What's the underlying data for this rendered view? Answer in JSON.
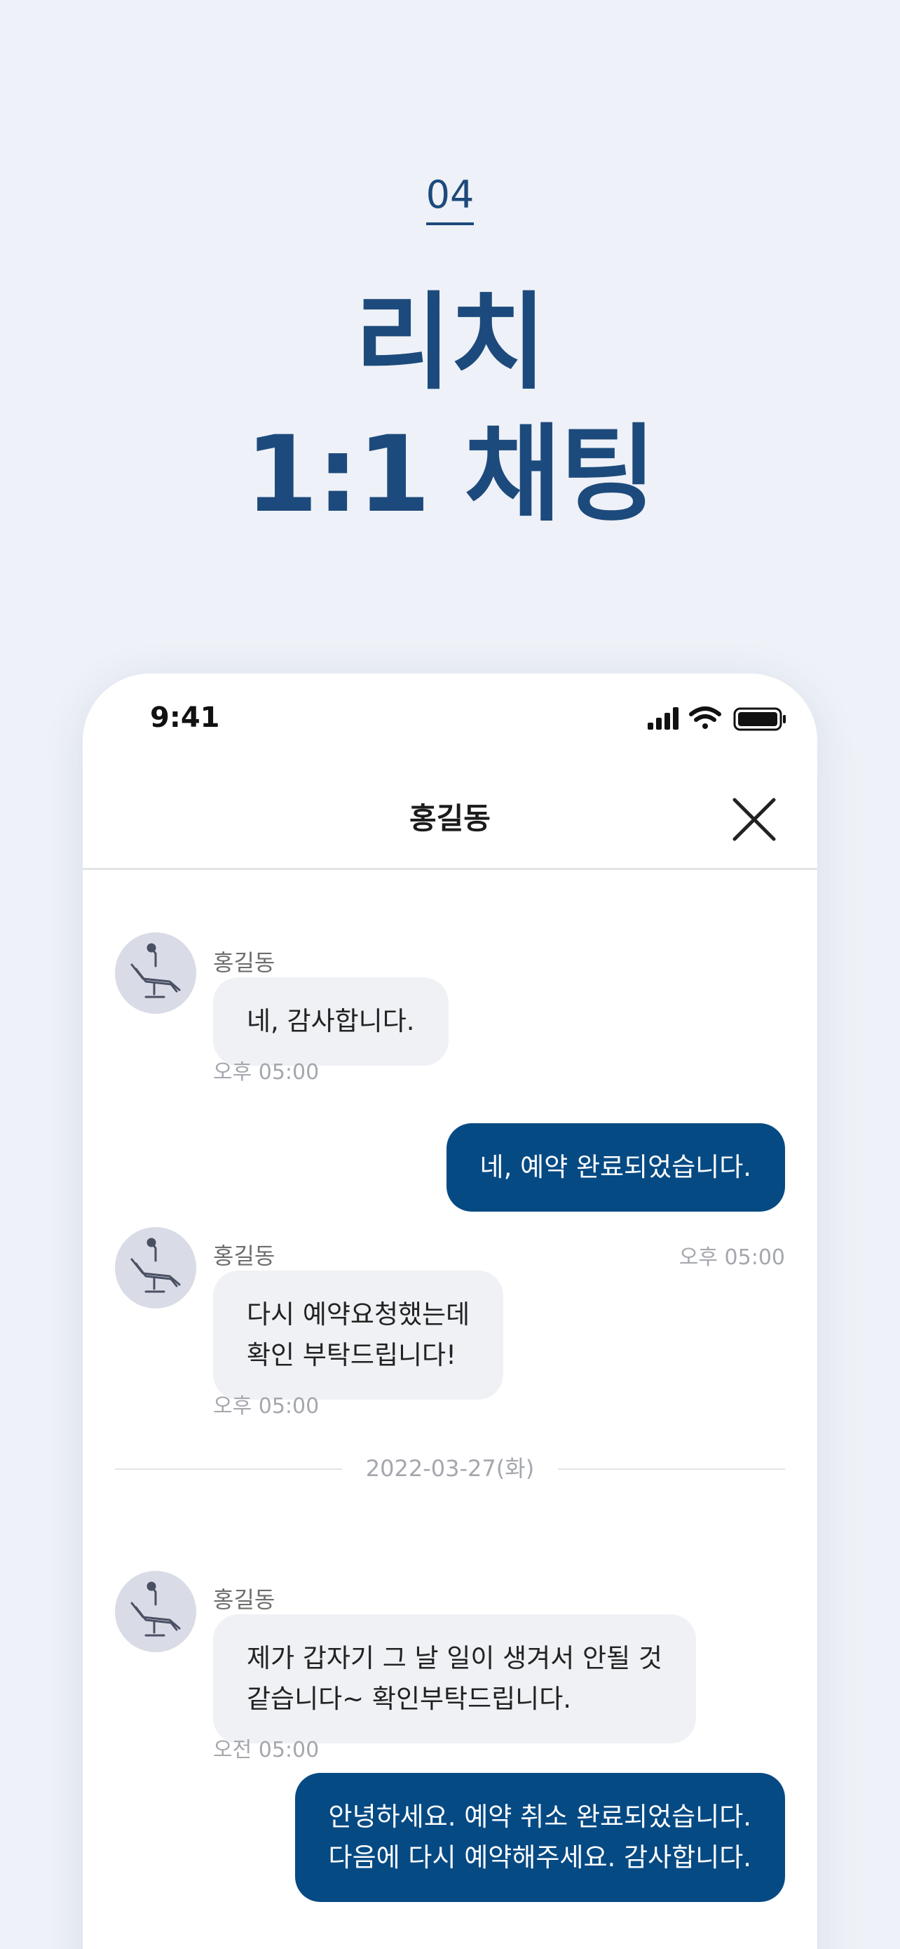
{
  "promo": {
    "number": "04",
    "title_line1": "리치",
    "title_line2": "1:1 채팅"
  },
  "status_bar": {
    "time": "9:41",
    "icons": [
      "cellular-signal-icon",
      "wifi-icon",
      "battery-icon"
    ]
  },
  "nav": {
    "title": "홍길동",
    "close_icon": "close-icon"
  },
  "messages": [
    {
      "direction": "in",
      "sender": "홍길동",
      "text": "네, 감사합니다.",
      "time": "오후 05:00"
    },
    {
      "direction": "out",
      "text": "네, 예약 완료되었습니다."
    },
    {
      "direction": "in",
      "sender": "홍길동",
      "text_line1": "다시 예약요청했는데",
      "text_line2": "확인 부탁드립니다!",
      "time": "오후 05:00",
      "side_time": "오후 05:00"
    },
    {
      "direction": "in",
      "sender": "홍길동",
      "text_line1": "제가 갑자기 그 날 일이 생겨서 안될 것",
      "text_line2": "같습니다~ 확인부탁드립니다.",
      "time": "오전 05:00"
    },
    {
      "direction": "out",
      "text_line1": "안녕하세요. 예약 취소 완료되었습니다.",
      "text_line2": "다음에 다시 예약해주세요. 감사합니다."
    }
  ],
  "date_separator": "2022-03-27(화)",
  "colors": {
    "background": "#eef1f7",
    "brand": "#1d4a7c",
    "outgoing_bubble": "#064a84",
    "incoming_bubble": "#eff1f5"
  },
  "avatar_icon": "dental-chair-icon"
}
